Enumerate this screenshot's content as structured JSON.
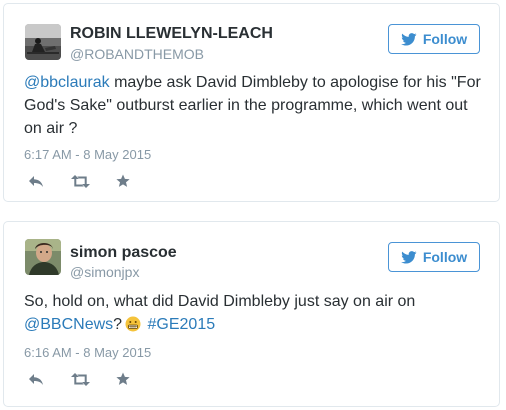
{
  "colors": {
    "link": "#2b7bb9",
    "follow_blue": "#3c8dcf",
    "meta_gray": "#8899a6",
    "text": "#292f33",
    "border": "#e1e8ed",
    "icon_gray": "#6e7d8a"
  },
  "icons": {
    "follow": "twitter-bird-icon",
    "reply": "reply-icon",
    "retweet": "retweet-icon",
    "favorite": "star-icon",
    "emoji": "grimacing-face-emoji"
  },
  "tweets": [
    {
      "display_name": "ROBIN LLEWELYN-LEACH",
      "handle": "@ROBANDTHEMOB",
      "follow_label": "Follow",
      "mention": "@bbclaurak",
      "text": " maybe ask David Dimbleby to apologise for his \"For God's Sake\" outburst earlier in the programme, which went out on air ?",
      "timestamp": "6:17 AM - 8 May 2015"
    },
    {
      "display_name": "simon pascoe",
      "handle": "@simonjpx",
      "follow_label": "Follow",
      "text_before": "So, hold on, what did David Dimbleby just say on air on ",
      "mention": "@BBCNews",
      "text_after": "?",
      "hashtag": "#GE2015",
      "timestamp": "6:16 AM - 8 May 2015"
    }
  ]
}
